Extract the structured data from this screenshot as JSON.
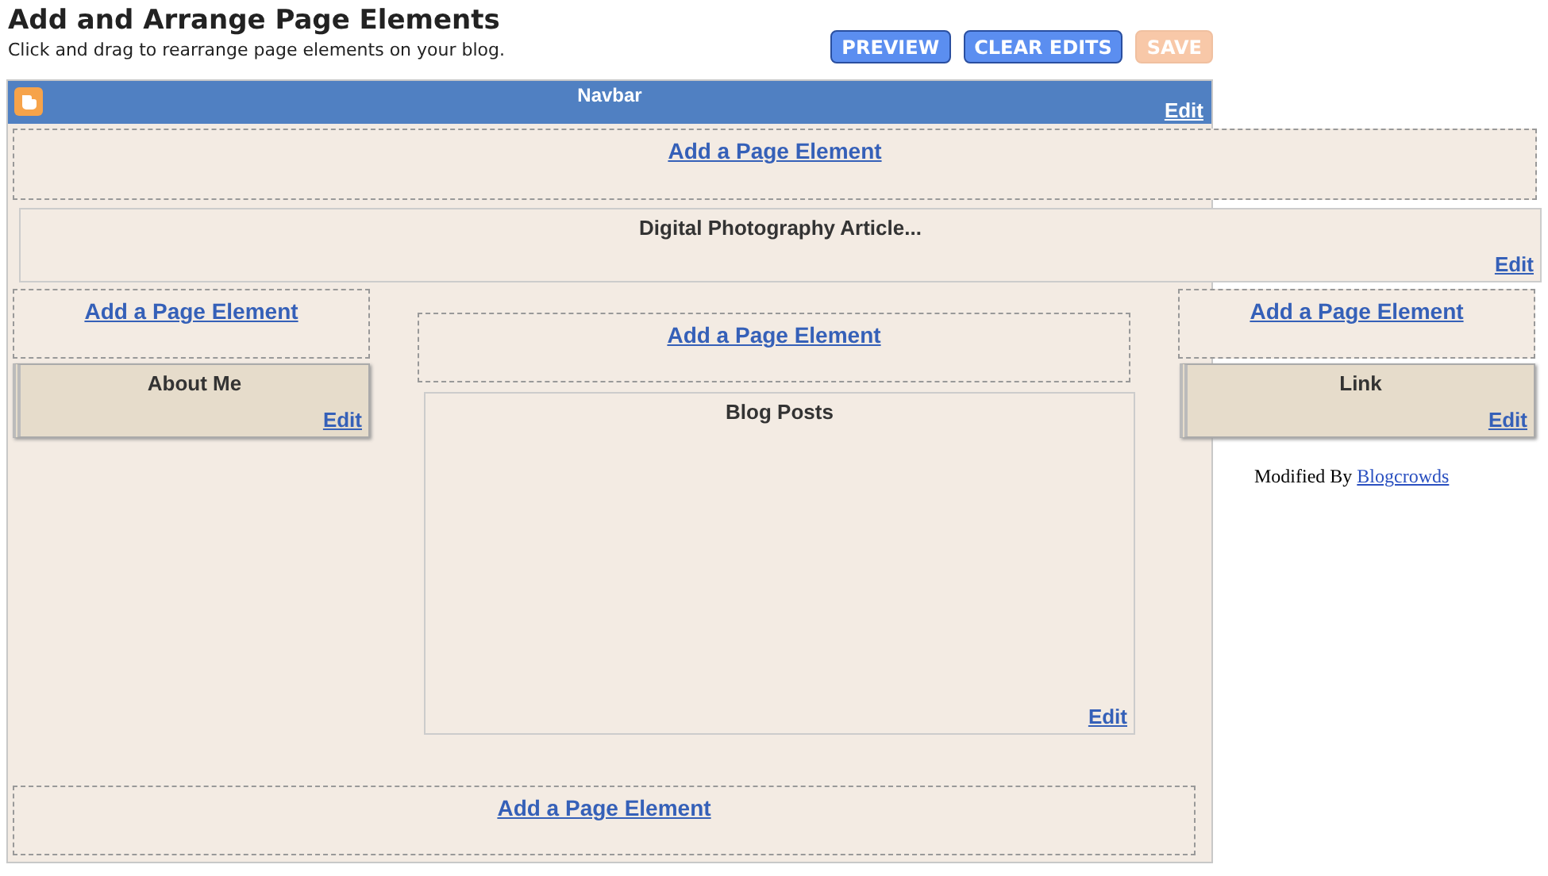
{
  "header": {
    "title": "Add and Arrange Page Elements",
    "subtitle": "Click and drag to rearrange page elements on your blog."
  },
  "buttons": [
    {
      "label": "PREVIEW",
      "disabled": false
    },
    {
      "label": "CLEAR EDITS",
      "disabled": false
    },
    {
      "label": "SAVE",
      "disabled": true
    }
  ],
  "navbar": {
    "title": "Navbar",
    "edit": "Edit"
  },
  "header_add": "Add a Page Element",
  "article": {
    "title": "Digital Photography Article...",
    "edit": "Edit"
  },
  "left_column": {
    "add": "Add a Page Element",
    "widget": {
      "title": "About Me",
      "edit": "Edit"
    }
  },
  "main_column": {
    "add": "Add a Page Element",
    "widget": {
      "title": "Blog Posts",
      "edit": "Edit"
    }
  },
  "right_column": {
    "add": "Add a Page Element",
    "widget": {
      "title": "Link",
      "edit": "Edit"
    },
    "credit": {
      "text": "Modified By",
      "link": "Blogcrowds"
    }
  },
  "footer_add": "Add a Page Element"
}
